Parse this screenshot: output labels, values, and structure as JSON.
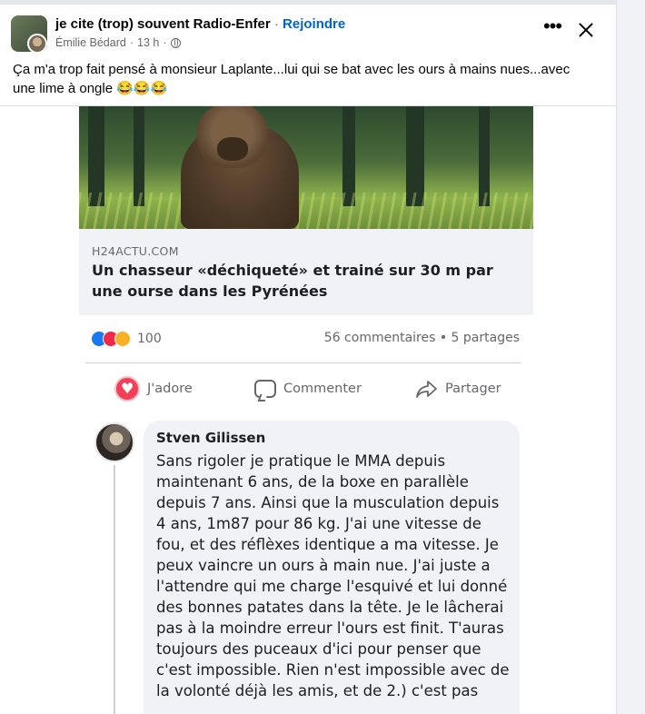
{
  "post": {
    "group_name": "je cite (trop) souvent Radio-Enfer",
    "separator": " · ",
    "join_label": "Rejoindre",
    "author": "Émilie Bédard",
    "time": "13 h",
    "more_icon": "ellipsis-icon",
    "close_icon": "close-icon",
    "text": "Ça m'a trop fait pensé à monsieur Laplante...lui qui se bat avec les ours à mains nues...avec une lime à ongle 😂😂😂"
  },
  "screenshot": {
    "link_preview": {
      "domain": "H24ACTU.COM",
      "title": "Un chasseur «déchiqueté» et trainé sur 30 m par une ourse dans les Pyrénées"
    },
    "reactions": {
      "icons": [
        "like-icon",
        "love-icon",
        "haha-icon"
      ],
      "count": "100"
    },
    "comments_shares": "56 commentaires • 5 partages",
    "actions": {
      "love": "J'adore",
      "comment": "Commenter",
      "share": "Partager"
    },
    "comment": {
      "author": "Stven Gilissen",
      "text": "Sans rigoler je pratique le MMA depuis maintenant 6 ans, de la boxe en parallèle depuis 7 ans. Ainsi que la musculation depuis 4 ans, 1m87 pour 86 kg. J'ai une vitesse de fou, et des réflèxes identique a ma vitesse. Je peux vaincre un ours à main nue. J'ai juste a l'attendre qui me charge l'esquivé et lui donné des bonnes patates dans la tête. Je le lâcherai pas à la moindre erreur l'ours est finit. T'auras toujours des puceaux d'ici pour penser que c'est impossible. Rien n'est impossible avec de la volonté déjà les amis, et de 2.) c'est pas"
    }
  },
  "colors": {
    "link_blue": "#0064d1",
    "like_blue": "#1877f2",
    "love_red": "#f33e58",
    "haha_yellow": "#f7b125",
    "meta_gray": "#65676b"
  }
}
